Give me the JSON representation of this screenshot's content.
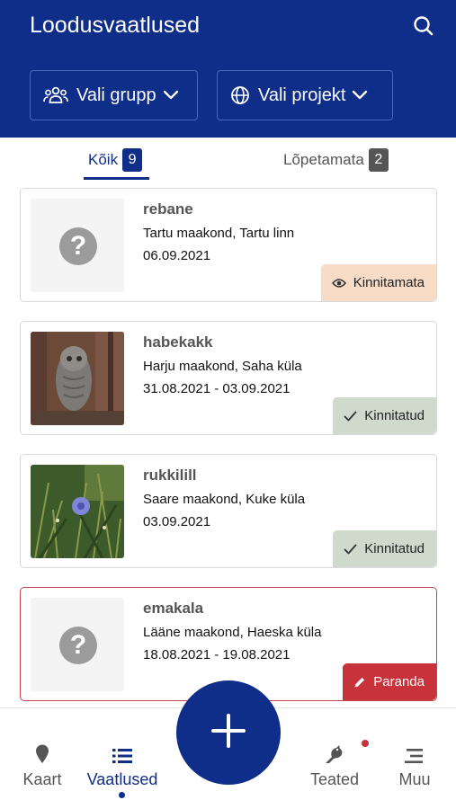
{
  "header": {
    "title": "Loodusvaatlused",
    "group_filter": "Vali grupp",
    "project_filter": "Vali projekt"
  },
  "tabs": [
    {
      "label": "Kõik",
      "count": "9",
      "active": true
    },
    {
      "label": "Lõpetamata",
      "count": "2",
      "active": false
    }
  ],
  "observations": [
    {
      "species": "rebane",
      "location": "Tartu maakond, Tartu linn",
      "date": "06.09.2021",
      "status": "Kinnitamata",
      "image": "question-placeholder"
    },
    {
      "species": "habekakk",
      "location": "Harju maakond, Saha küla",
      "date": "31.08.2021 - 03.09.2021",
      "status": "Kinnitatud",
      "image": "owl-photo"
    },
    {
      "species": "rukkilill",
      "location": "Saare maakond, Kuke küla",
      "date": "03.09.2021",
      "status": "Kinnitatud",
      "image": "cornflower-photo"
    },
    {
      "species": "emakala",
      "location": "Lääne maakond, Haeska küla",
      "date": "18.08.2021 - 19.08.2021",
      "status": "Paranda",
      "image": "question-placeholder"
    }
  ],
  "bottom_nav": {
    "map": "Kaart",
    "observations": "Vaatlused",
    "messages": "Teated",
    "more": "Muu"
  },
  "colors": {
    "brand": "#0f2e8a",
    "unconfirmed": "#f6dcc7",
    "confirmed": "#cfdacc",
    "fix": "#c8323b"
  }
}
